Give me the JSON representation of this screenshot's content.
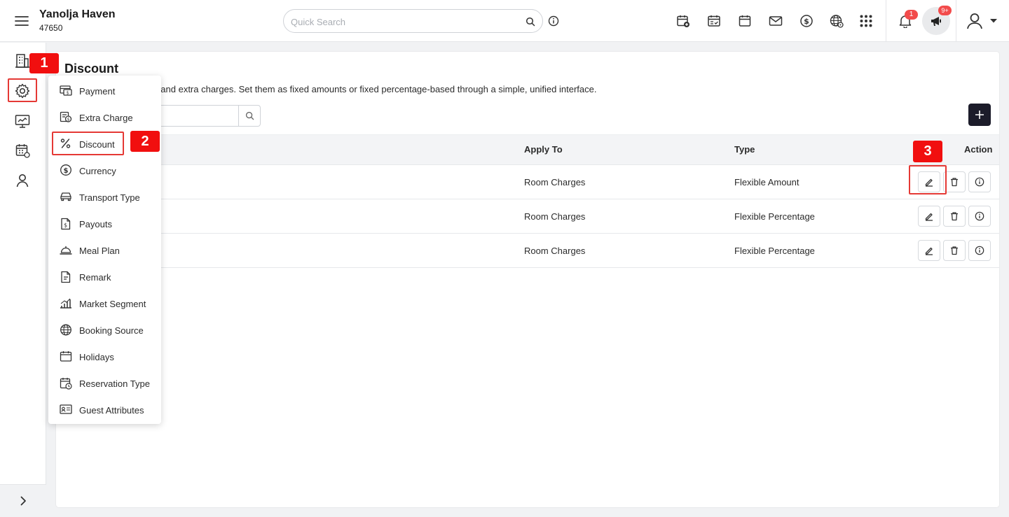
{
  "header": {
    "hotel_name": "Yanolja Haven",
    "hotel_code": "47650",
    "search_placeholder": "Quick Search",
    "notifications_count": "1",
    "announcements_count": "9+",
    "icons": [
      "calendar-add-icon",
      "calendar-check-icon",
      "calendar-icon",
      "mail-icon",
      "dollar-icon",
      "globe-icon",
      "apps-grid-icon"
    ]
  },
  "rail": {
    "items": [
      "building-icon",
      "gear-icon",
      "monitor-icon",
      "calendar-grid-icon",
      "user-icon"
    ]
  },
  "page": {
    "title": "Discount",
    "description": "ounts for room charges and extra charges. Set them as fixed amounts or fixed percentage-based through a simple, unified interface."
  },
  "table": {
    "columns": {
      "apply_to": "Apply To",
      "type": "Type",
      "action": "Action"
    },
    "rows": [
      {
        "apply_to": "Room Charges",
        "type": "Flexible Amount"
      },
      {
        "apply_to": "Room Charges",
        "type": "Flexible Percentage"
      },
      {
        "apply_to": "Room Charges",
        "type": "Flexible Percentage"
      }
    ]
  },
  "menu": {
    "items": [
      {
        "label": "Payment",
        "icon": "payment-icon"
      },
      {
        "label": "Extra Charge",
        "icon": "extra-charge-icon"
      },
      {
        "label": "Discount",
        "icon": "percent-icon"
      },
      {
        "label": "Currency",
        "icon": "currency-icon"
      },
      {
        "label": "Transport Type",
        "icon": "car-icon"
      },
      {
        "label": "Payouts",
        "icon": "payouts-icon"
      },
      {
        "label": "Meal Plan",
        "icon": "cloche-icon"
      },
      {
        "label": "Remark",
        "icon": "document-icon"
      },
      {
        "label": "Market Segment",
        "icon": "bar-chart-icon"
      },
      {
        "label": "Booking Source",
        "icon": "globe-icon"
      },
      {
        "label": "Holidays",
        "icon": "calendar-icon"
      },
      {
        "label": "Reservation Type",
        "icon": "calendar-clock-icon"
      },
      {
        "label": "Guest Attributes",
        "icon": "id-card-icon"
      }
    ]
  },
  "annotations": {
    "step1": "1",
    "step2": "2",
    "step3": "3",
    "color": "#f10f0f"
  }
}
